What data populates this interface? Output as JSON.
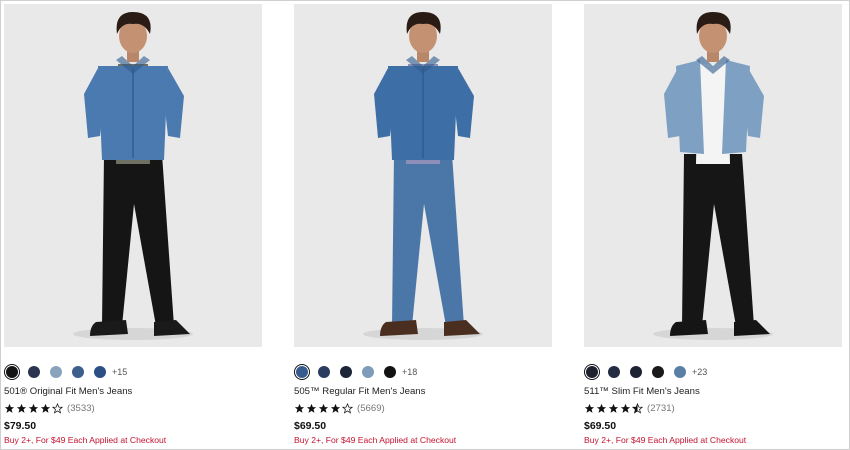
{
  "products": [
    {
      "name": "501® Original Fit Men's Jeans",
      "rating": 4,
      "rating_count": "(3533)",
      "price": "$79.50",
      "promo": "Buy 2+, For $49 Each Applied at Checkout",
      "more_colors": "+15",
      "swatches": [
        "#141414",
        "#2c3550",
        "#8aa3bd",
        "#3d5f8c",
        "#2c4f84"
      ],
      "selected_swatch": 0,
      "image": {
        "jacket": "#4a7ab0",
        "inner": "#6f6f62",
        "pants": "#151515",
        "shoe": "#1a1a1a",
        "open": false
      }
    },
    {
      "name": "505™ Regular Fit Men's Jeans",
      "rating": 4,
      "rating_count": "(5669)",
      "price": "$69.50",
      "promo": "Buy 2+, For $49 Each Applied at Checkout",
      "more_colors": "+18",
      "swatches": [
        "#365b8f",
        "#2b3d5e",
        "#1d2538",
        "#7f9cbb",
        "#121212"
      ],
      "selected_swatch": 0,
      "image": {
        "jacket": "#3e6ea6",
        "inner": "#8e8fb8",
        "pants": "#4b77a8",
        "shoe": "#4a2e20",
        "open": false
      }
    },
    {
      "name": "511™ Slim Fit Men's Jeans",
      "rating": 4.5,
      "rating_count": "(2731)",
      "price": "$69.50",
      "promo": "Buy 2+, For $49 Each Applied at Checkout",
      "more_colors": "+23",
      "swatches": [
        "#1d2130",
        "#232c40",
        "#1e2333",
        "#1a1a1a",
        "#5a7fa5"
      ],
      "selected_swatch": 0,
      "image": {
        "jacket": "#7ea0c2",
        "inner": "#f4f4f4",
        "pants": "#161616",
        "shoe": "#151515",
        "open": true
      }
    }
  ]
}
